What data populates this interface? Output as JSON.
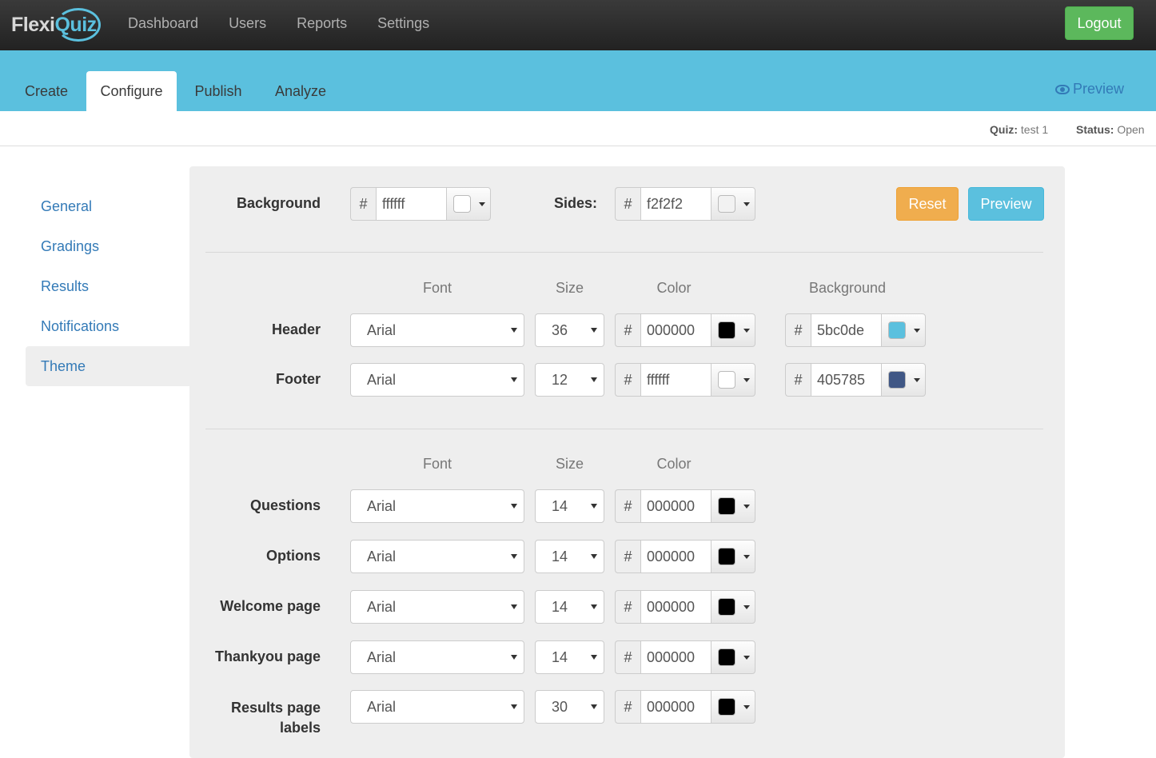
{
  "brand": {
    "part1": "Flexi",
    "part2": "Quiz"
  },
  "topnav": {
    "items": [
      "Dashboard",
      "Users",
      "Reports",
      "Settings"
    ],
    "logout": "Logout"
  },
  "tabs": {
    "items": [
      "Create",
      "Configure",
      "Publish",
      "Analyze"
    ],
    "active": "Configure",
    "preview": "Preview"
  },
  "status": {
    "quiz_label": "Quiz:",
    "quiz_value": "test 1",
    "status_label": "Status:",
    "status_value": "Open"
  },
  "sidebar": {
    "items": [
      "General",
      "Gradings",
      "Results",
      "Notifications",
      "Theme"
    ],
    "active": "Theme"
  },
  "colors": {
    "accent": "#5bc0de",
    "success": "#5cb85c",
    "warning": "#f0ad4e",
    "link": "#337ab7"
  },
  "theme": {
    "background": {
      "label": "Background",
      "hash": "#",
      "value": "ffffff",
      "swatch": "#ffffff"
    },
    "sides": {
      "label": "Sides:",
      "hash": "#",
      "value": "f2f2f2",
      "swatch": "#f2f2f2"
    },
    "reset_label": "Reset",
    "preview_label": "Preview",
    "section1": {
      "headers": {
        "font": "Font",
        "size": "Size",
        "color": "Color",
        "background": "Background"
      },
      "rows": [
        {
          "label": "Header",
          "font": "Arial",
          "size": "36",
          "color": "000000",
          "color_swatch": "#000000",
          "bg": "5bc0de",
          "bg_swatch": "#5bc0de"
        },
        {
          "label": "Footer",
          "font": "Arial",
          "size": "12",
          "color": "ffffff",
          "color_swatch": "#ffffff",
          "bg": "405785",
          "bg_swatch": "#405785"
        }
      ]
    },
    "section2": {
      "headers": {
        "font": "Font",
        "size": "Size",
        "color": "Color"
      },
      "rows": [
        {
          "label": "Questions",
          "font": "Arial",
          "size": "14",
          "color": "000000",
          "color_swatch": "#000000"
        },
        {
          "label": "Options",
          "font": "Arial",
          "size": "14",
          "color": "000000",
          "color_swatch": "#000000"
        },
        {
          "label": "Welcome page",
          "font": "Arial",
          "size": "14",
          "color": "000000",
          "color_swatch": "#000000"
        },
        {
          "label": "Thankyou page",
          "font": "Arial",
          "size": "14",
          "color": "000000",
          "color_swatch": "#000000"
        },
        {
          "label": "Results page labels",
          "font": "Arial",
          "size": "30",
          "color": "000000",
          "color_swatch": "#000000"
        }
      ]
    }
  }
}
